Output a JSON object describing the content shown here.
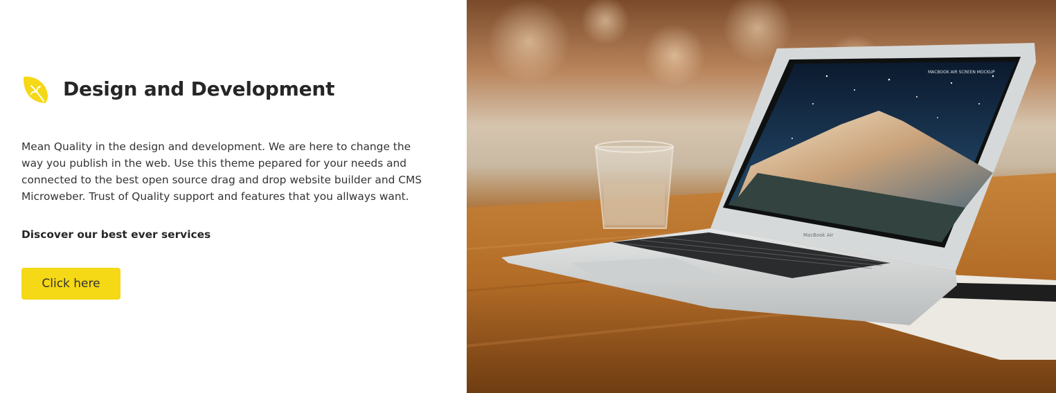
{
  "feature": {
    "title": "Design and Development",
    "description": "Mean Quality in the design and development. We are here to change the way you publish in the web. Use this theme pepared for your needs and connected to the best open source drag and drop website builder and CMS Microweber. Trust of Quality support and features that you allways want.",
    "subheading": "Discover our best ever services",
    "button_label": "Click here",
    "icon": "leaf-icon"
  },
  "colors": {
    "accent": "#f5d816",
    "text_dark": "#262626",
    "text_body": "#333333",
    "background": "#ffffff"
  },
  "image": {
    "subject": "laptop-on-wooden-table-photo",
    "screen_caption": "MACBOOK AIR SCREEN MOCKUP",
    "laptop_label": "MacBook Air"
  }
}
